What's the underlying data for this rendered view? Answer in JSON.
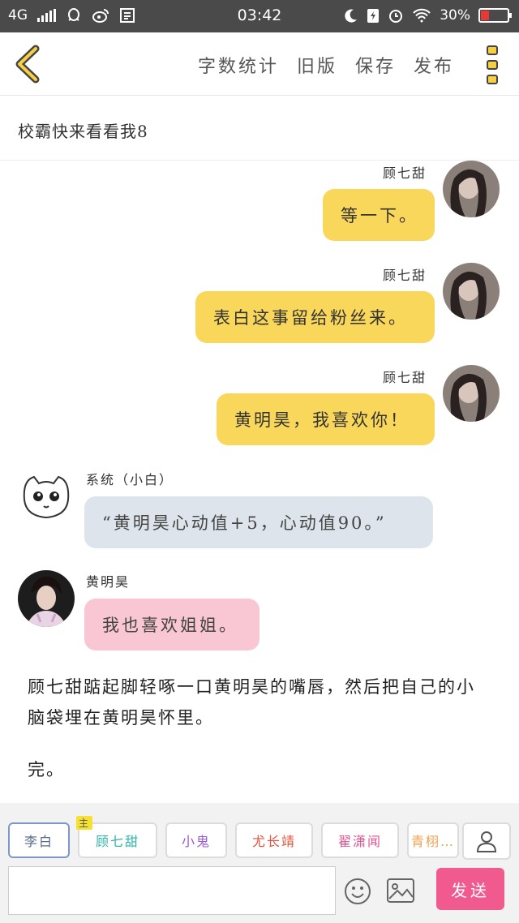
{
  "status_bar": {
    "network": "4G",
    "time": "03:42",
    "battery": "30%"
  },
  "toolbar": {
    "actions": [
      "字数统计",
      "旧版",
      "保存",
      "发布"
    ]
  },
  "title": "校霸快来看看我8",
  "messages": [
    {
      "name": "顾七甜",
      "text": "等一下。"
    },
    {
      "name": "顾七甜",
      "text": "表白这事留给粉丝来。"
    },
    {
      "name": "顾七甜",
      "text": "黄明昊，我喜欢你！"
    },
    {
      "name": "系统（小白）",
      "text": "“黄明昊心动值+5，心动值90。”"
    },
    {
      "name": "黄明昊",
      "text": "我也喜欢姐姐。"
    }
  ],
  "narration": [
    "顾七甜踮起脚轻啄一口黄明昊的嘴唇，然后把自己的小脑袋埋在黄明昊怀里。",
    "完。"
  ],
  "characters": {
    "chips": [
      {
        "label": "李白",
        "color": "#5a6a8a"
      },
      {
        "label": "顾七甜",
        "color": "#2fb5a8",
        "tag": "主"
      },
      {
        "label": "小鬼",
        "color": "#9a5bd6"
      },
      {
        "label": "尤长靖",
        "color": "#e0533f"
      },
      {
        "label": "翟潇闻",
        "color": "#e0538f"
      },
      {
        "label": "青栩…",
        "color": "#f0a050"
      }
    ]
  },
  "composer": {
    "placeholder": "",
    "send_label": "发送"
  }
}
